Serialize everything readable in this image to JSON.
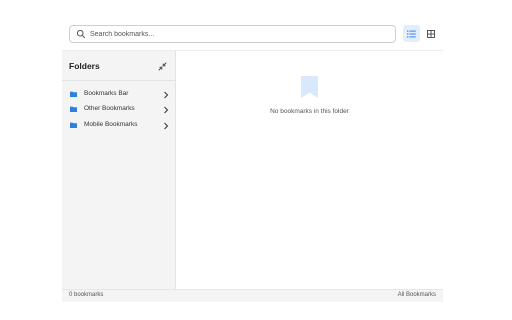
{
  "search": {
    "placeholder": "Search bookmarks...",
    "value": ""
  },
  "toolbar": {
    "list_view_icon": "list-icon",
    "grid_view_icon": "grid-icon",
    "active_view": "list",
    "accent_color": "#3b82f6"
  },
  "sidebar": {
    "title": "Folders",
    "collapse_icon": "collapse-icon",
    "items": [
      {
        "label": "Bookmarks Bar",
        "icon": "folder-icon"
      },
      {
        "label": "Other Bookmarks",
        "icon": "folder-icon"
      },
      {
        "label": "Mobile Bookmarks",
        "icon": "folder-icon"
      }
    ]
  },
  "main": {
    "empty_icon": "bookmark-icon",
    "empty_message": "No bookmarks in this folder"
  },
  "status": {
    "count": "0 bookmarks",
    "current_folder": "All Bookmarks"
  }
}
